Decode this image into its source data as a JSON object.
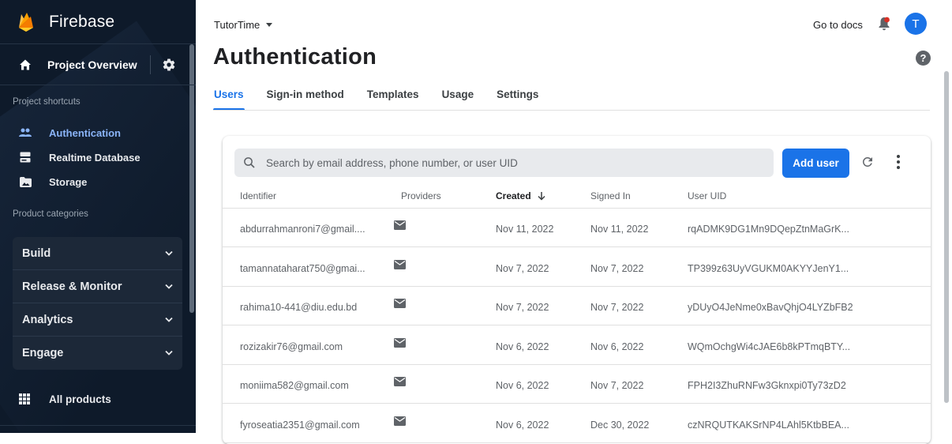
{
  "sidebar": {
    "brand": "Firebase",
    "project_overview": "Project Overview",
    "shortcuts_label": "Project shortcuts",
    "shortcuts": [
      {
        "label": "Authentication",
        "icon": "people-icon",
        "active": true
      },
      {
        "label": "Realtime Database",
        "icon": "database-icon",
        "active": false
      },
      {
        "label": "Storage",
        "icon": "image-folder-icon",
        "active": false
      }
    ],
    "categories_label": "Product categories",
    "categories": [
      {
        "label": "Build"
      },
      {
        "label": "Release & Monitor"
      },
      {
        "label": "Analytics"
      },
      {
        "label": "Engage"
      }
    ],
    "all_products": "All products"
  },
  "header": {
    "project_name": "TutorTime",
    "docs_link": "Go to docs",
    "avatar_initial": "T",
    "help": "?"
  },
  "page": {
    "title": "Authentication",
    "tabs": [
      {
        "label": "Users",
        "active": true
      },
      {
        "label": "Sign-in method",
        "active": false
      },
      {
        "label": "Templates",
        "active": false
      },
      {
        "label": "Usage",
        "active": false
      },
      {
        "label": "Settings",
        "active": false
      }
    ]
  },
  "users": {
    "search_placeholder": "Search by email address, phone number, or user UID",
    "add_user_label": "Add user",
    "columns": [
      "Identifier",
      "Providers",
      "Created",
      "Signed In",
      "User UID"
    ],
    "sorted_column": "Created",
    "rows": [
      {
        "identifier": "abdurrahmanroni7@gmail....",
        "provider": "email-icon",
        "created": "Nov 11, 2022",
        "signed_in": "Nov 11, 2022",
        "uid": "rqADMK9DG1Mn9DQepZtnMaGrK..."
      },
      {
        "identifier": "tamannataharat750@gmai...",
        "provider": "email-icon",
        "created": "Nov 7, 2022",
        "signed_in": "Nov 7, 2022",
        "uid": "TP399z63UyVGUKM0AKYYJenY1..."
      },
      {
        "identifier": "rahima10-441@diu.edu.bd",
        "provider": "email-icon",
        "created": "Nov 7, 2022",
        "signed_in": "Nov 7, 2022",
        "uid": "yDUyO4JeNme0xBavQhjO4LYZbFB2"
      },
      {
        "identifier": "rozizakir76@gmail.com",
        "provider": "email-icon",
        "created": "Nov 6, 2022",
        "signed_in": "Nov 6, 2022",
        "uid": "WQmOchgWi4cJAE6b8kPTmqBTY..."
      },
      {
        "identifier": "moniima582@gmail.com",
        "provider": "email-icon",
        "created": "Nov 6, 2022",
        "signed_in": "Nov 7, 2022",
        "uid": "FPH2I3ZhuRNFw3Gknxpi0Ty73zD2"
      },
      {
        "identifier": "fyroseatia2351@gmail.com",
        "provider": "email-icon",
        "created": "Nov 6, 2022",
        "signed_in": "Dec 30, 2022",
        "uid": "czNRQUTKAKSrNP4LAhl5KtbBEA..."
      }
    ]
  },
  "colors": {
    "sidebar_bg": "#0e1a2a",
    "accent": "#1a73e8",
    "active_shortcut": "#8ab4f8",
    "brand_flame": "#ffa000"
  }
}
